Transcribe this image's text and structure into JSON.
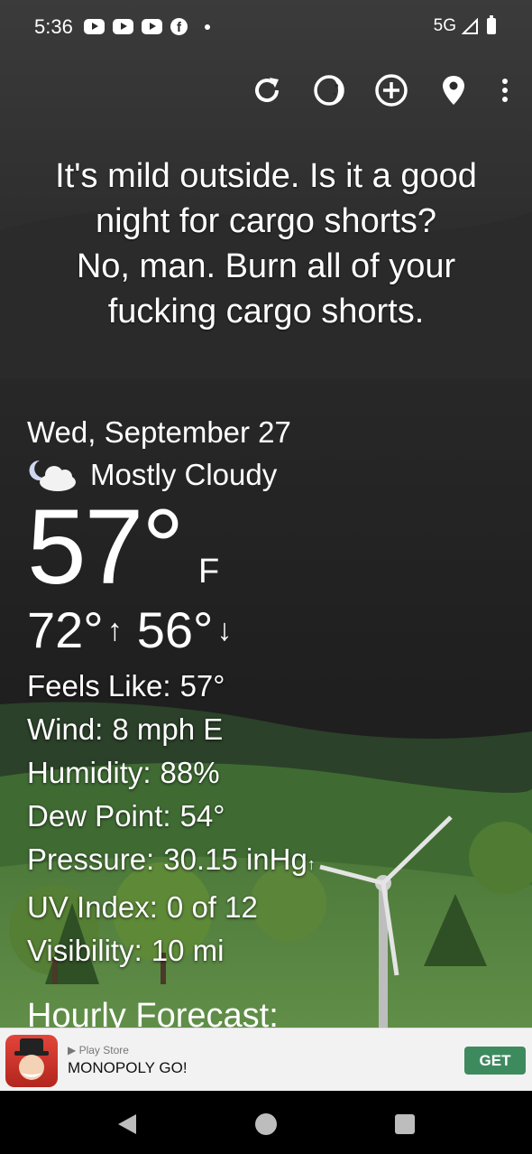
{
  "status": {
    "time": "5:36",
    "network": "5G",
    "notification_icons": [
      "youtube-icon",
      "youtube-icon",
      "youtube-icon",
      "facebook-icon"
    ]
  },
  "toolbar": {
    "icons": [
      "refresh-icon",
      "moon-phase-icon",
      "add-location-icon",
      "location-pin-icon",
      "more-vert-icon"
    ]
  },
  "headline": {
    "line1": "It's mild outside. Is it a good",
    "line2": "night for cargo shorts?",
    "line3": "No, man. Burn all of your",
    "line4": "fucking cargo shorts."
  },
  "weather": {
    "date": "Wed, September 27",
    "condition": "Mostly Cloudy",
    "condition_icon": "partly-cloudy-night-icon",
    "temperature": "57°",
    "unit": "F",
    "high": "72°",
    "low": "56°",
    "high_arrow": "↑",
    "low_arrow": "↓",
    "details": [
      {
        "label": "Feels Like:",
        "value": "57°"
      },
      {
        "label": "Wind:",
        "value": "8 mph E"
      },
      {
        "label": "Humidity:",
        "value": "88%"
      },
      {
        "label": "Dew Point:",
        "value": "54°"
      },
      {
        "label": "Pressure:",
        "value": "30.15 inHg",
        "trend": "↑"
      },
      {
        "label": "UV Index:",
        "value": "0 of 12"
      },
      {
        "label": "Visibility:",
        "value": "10 mi"
      }
    ],
    "hourly_title": "Hourly Forecast:"
  },
  "ad": {
    "store": "Play Store",
    "title": "MONOPOLY GO!",
    "button": "GET",
    "button_color": "#3e8a5f"
  },
  "colors": {
    "background": "#1d1d1d",
    "hill": "#5a8a3e",
    "text": "#ffffff"
  }
}
